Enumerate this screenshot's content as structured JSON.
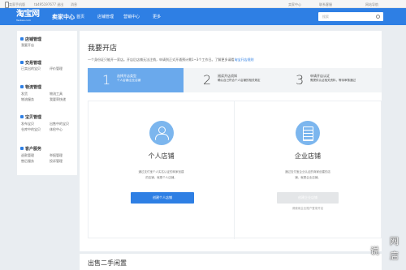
{
  "util_bar": {
    "mobile": "卖家手机版",
    "user": "tb495197677 退出",
    "messages": "消息",
    "items_right": [
      "卖家中心",
      "联系客服",
      "网站导航"
    ]
  },
  "header": {
    "logo": "淘宝网",
    "logo_sub": "Taobao.com",
    "title": "卖家中心",
    "nav": [
      "首页",
      "店铺管理",
      "营销中心",
      "更多"
    ],
    "search_placeholder": "搜索"
  },
  "sidebar": {
    "groups": [
      {
        "title": "店铺管理",
        "items": [
          "我要开店"
        ]
      },
      {
        "title": "交易管理",
        "items": [
          "已卖出的宝贝",
          "评价管理"
        ]
      },
      {
        "title": "物流管理",
        "items": [
          "发货",
          "物流工具",
          "物流服务",
          "我要寄快递"
        ]
      },
      {
        "title": "宝贝管理",
        "items": [
          "发布宝贝",
          "出售中的宝贝",
          "仓库中的宝贝",
          "体检中心"
        ]
      },
      {
        "title": "客户服务",
        "items": [
          "退款管理",
          "举报管理",
          "售后服务",
          "投诉管理"
        ]
      }
    ]
  },
  "main": {
    "title": "我要开店",
    "notice": "一个身份证只能开一家店。开店后店铺无法注销，申请到正式开通预计需1~3个工作日。了解更多请看",
    "notice_link": "淘宝开店规则",
    "steps": [
      {
        "num": "1",
        "title": "选择开店类型",
        "desc": "个人店铺/企业店铺"
      },
      {
        "num": "2",
        "title": "阅读开店须知",
        "desc": "确认自己符合个人店铺的相关规定"
      },
      {
        "num": "3",
        "title": "申请开店认证",
        "desc": "需提供认证相关资料，等待审核通过"
      }
    ],
    "cards": [
      {
        "title": "个人店铺",
        "desc_lines": [
          "通过支付宝个人实名认证的商家创建",
          "的店铺，就是个人店铺。"
        ],
        "button": "创建个人店铺",
        "link": ""
      },
      {
        "title": "企业店铺",
        "desc_lines": [
          "通过支付宝企业认证的商家创建的店",
          "铺，就是企业店铺。"
        ],
        "button": "创建企业店铺",
        "link": "请使用企业账户登录开店"
      }
    ]
  },
  "section2": {
    "title": "出售二手闲置"
  },
  "watermark": [
    "说",
    "网",
    "店"
  ],
  "colors": {
    "brand": "#2e7fe4",
    "step_active": "#6aa9ec",
    "icon_bg": "#7cb6ee"
  }
}
